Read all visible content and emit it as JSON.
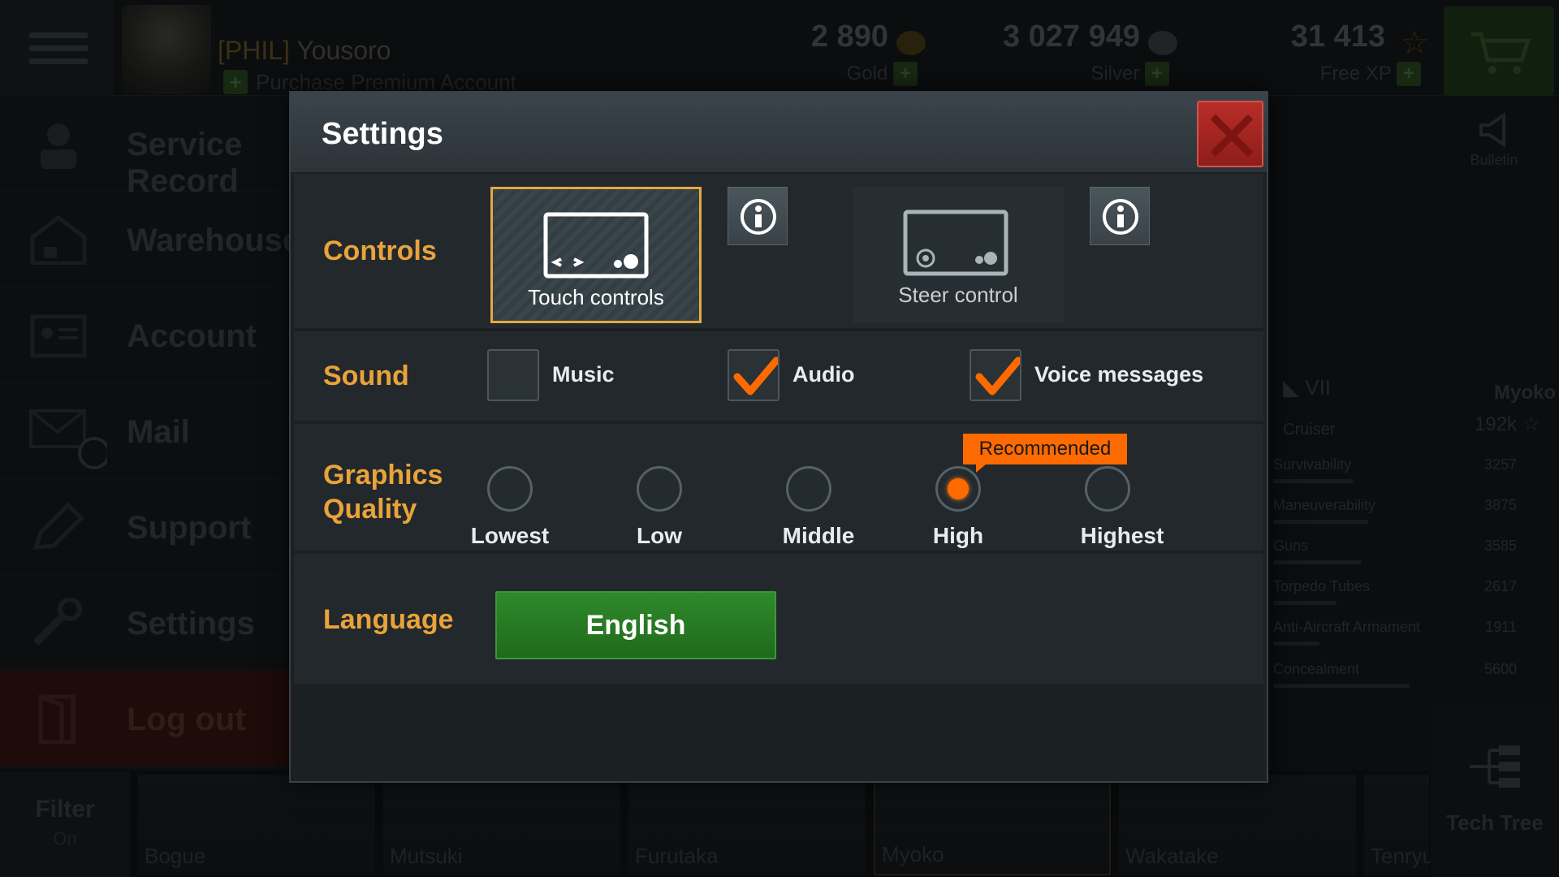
{
  "header": {
    "clan": "[PHIL]",
    "player_name": "Yousoro",
    "premium_label": "Purchase Premium Account",
    "gold": {
      "value": "2 890",
      "label": "Gold"
    },
    "silver": {
      "value": "3 027 949",
      "label": "Silver"
    },
    "free_xp": {
      "value": "31 413",
      "label": "Free XP"
    }
  },
  "sidebar": {
    "items": [
      {
        "label": "Service Record",
        "icon": "sailor-icon"
      },
      {
        "label": "Warehouse",
        "icon": "warehouse-icon"
      },
      {
        "label": "Account",
        "icon": "account-card-icon"
      },
      {
        "label": "Mail",
        "icon": "mail-icon"
      },
      {
        "label": "Support",
        "icon": "pencil-icon"
      },
      {
        "label": "Settings",
        "icon": "wrench-icon"
      },
      {
        "label": "Log out",
        "icon": "door-icon"
      }
    ]
  },
  "right_panel": {
    "bulletin_label": "Bulletin",
    "ship_tier": "VII",
    "ship_type": "Cruiser",
    "ship_name": "Myoko",
    "ship_xp": "192k",
    "stats": [
      {
        "label": "Survivability",
        "value": "3257",
        "fraction": 0.33
      },
      {
        "label": "Maneuverability",
        "value": "3875",
        "fraction": 0.39
      },
      {
        "label": "Guns",
        "value": "3585",
        "fraction": 0.36
      },
      {
        "label": "Torpedo Tubes",
        "value": "2617",
        "fraction": 0.26
      },
      {
        "label": "Anti-Aircraft Armament",
        "value": "1911",
        "fraction": 0.19
      },
      {
        "label": "Concealment",
        "value": "5600",
        "fraction": 0.56
      }
    ],
    "tech_tree_label": "Tech Tree"
  },
  "carousel": {
    "filter_label": "Filter",
    "filter_state": "On",
    "ships": [
      "Bogue",
      "Mutsuki",
      "Furutaka",
      "Myoko",
      "Wakatake",
      "Tenryu"
    ],
    "selected_ship": "Myoko"
  },
  "dialog": {
    "title": "Settings",
    "controls": {
      "label": "Controls",
      "options": [
        {
          "label": "Touch controls",
          "selected": true
        },
        {
          "label": "Steer control",
          "selected": false
        }
      ]
    },
    "sound": {
      "label": "Sound",
      "options": [
        {
          "label": "Music",
          "checked": false
        },
        {
          "label": "Audio",
          "checked": true
        },
        {
          "label": "Voice messages",
          "checked": true
        }
      ]
    },
    "graphics": {
      "label_line1": "Graphics",
      "label_line2": "Quality",
      "options": [
        "Lowest",
        "Low",
        "Middle",
        "High",
        "Highest"
      ],
      "selected": "High",
      "recommended_badge": "Recommended"
    },
    "language": {
      "label": "Language",
      "value": "English"
    }
  },
  "colors": {
    "accent_orange": "#ff6a00",
    "label_gold": "#e9a33a",
    "close_red": "#b92d28",
    "language_green": "#2f8a2b"
  }
}
